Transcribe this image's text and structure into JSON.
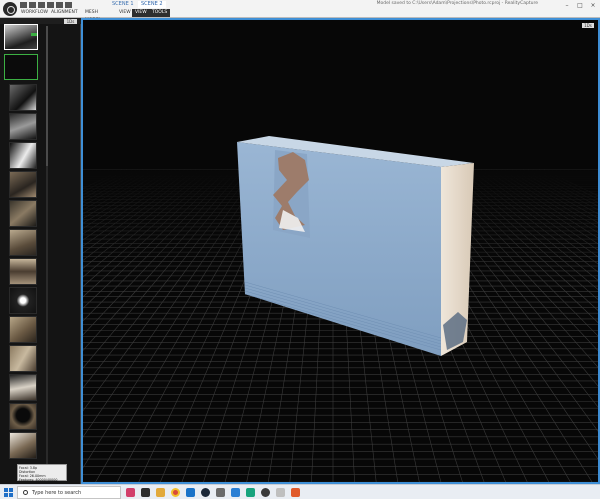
{
  "app": {
    "scene_tabs": [
      "SCENE 1",
      "SCENE 2"
    ],
    "active_scene_tab": 1,
    "menus": [
      "WORKFLOW",
      "ALIGNMENT",
      "MESH MODEL",
      "VIEW",
      "VIEW",
      "TOOLS"
    ],
    "active_menus": [
      4,
      5
    ],
    "status": "Model saved to C:\\Users\\Adam\\Projections\\Photo.rcproj - RealityCapture",
    "window_controls": [
      "–",
      "□",
      "×"
    ]
  },
  "left_panel": {
    "header_button": "1Ds",
    "info_lines": [
      "Focal: 3.8p",
      "Distortion",
      "Focal: 26.00mm",
      "Features: 40000/40000",
      "Focal: 26.00mm"
    ]
  },
  "viewport": {
    "corner_button": "1Ds"
  },
  "taskbar": {
    "search_placeholder": "Type here to search"
  },
  "colors": {
    "accent": "#3f8fd6",
    "selection_green": "#3cb043",
    "model_face": "#8ba8c8",
    "model_side": "#e3d7c7"
  }
}
